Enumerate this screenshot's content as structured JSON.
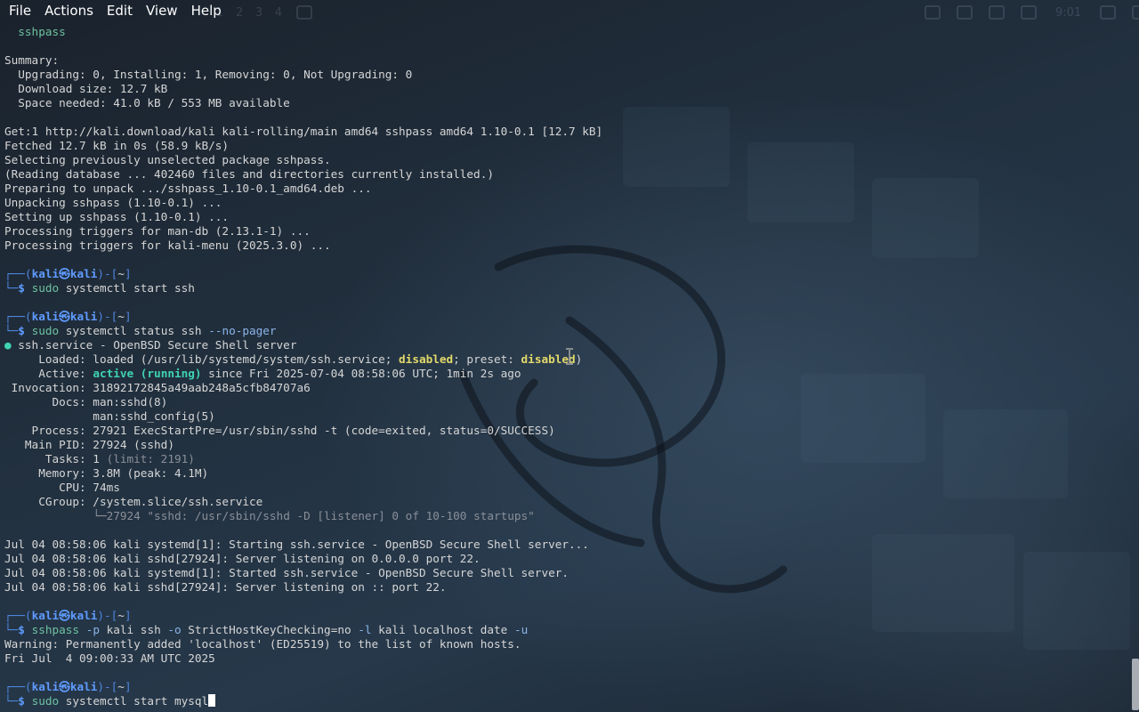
{
  "menu": [
    "File",
    "Actions",
    "Edit",
    "View",
    "Help"
  ],
  "ghost_panel": {
    "workspaces": [
      "1",
      "2",
      "3",
      "4"
    ],
    "clock": "9:01"
  },
  "prompt": {
    "user": "kali",
    "sep": "㉿",
    "host": "kali",
    "dir": "~"
  },
  "lines": [
    {
      "t": "out",
      "s": [
        {
          "c": "green",
          "x": "  sshpass"
        }
      ]
    },
    {
      "t": "blank"
    },
    {
      "t": "out",
      "s": [
        {
          "x": "Summary:"
        }
      ]
    },
    {
      "t": "out",
      "s": [
        {
          "x": "  Upgrading: 0, Installing: 1, Removing: 0, Not Upgrading: 0"
        }
      ]
    },
    {
      "t": "out",
      "s": [
        {
          "x": "  Download size: 12.7 kB"
        }
      ]
    },
    {
      "t": "out",
      "s": [
        {
          "x": "  Space needed: 41.0 kB / 553 MB available"
        }
      ]
    },
    {
      "t": "blank"
    },
    {
      "t": "out",
      "s": [
        {
          "x": "Get:1 http://kali.download/kali kali-rolling/main amd64 sshpass amd64 1.10-0.1 [12.7 kB]"
        }
      ]
    },
    {
      "t": "out",
      "s": [
        {
          "x": "Fetched 12.7 kB in 0s (58.9 kB/s)"
        }
      ]
    },
    {
      "t": "out",
      "s": [
        {
          "x": "Selecting previously unselected package sshpass."
        }
      ]
    },
    {
      "t": "out",
      "s": [
        {
          "x": "(Reading database ... 402460 files and directories currently installed.)"
        }
      ]
    },
    {
      "t": "out",
      "s": [
        {
          "x": "Preparing to unpack .../sshpass_1.10-0.1_amd64.deb ..."
        }
      ]
    },
    {
      "t": "out",
      "s": [
        {
          "x": "Unpacking sshpass (1.10-0.1) ..."
        }
      ]
    },
    {
      "t": "out",
      "s": [
        {
          "x": "Setting up sshpass (1.10-0.1) ..."
        }
      ]
    },
    {
      "t": "out",
      "s": [
        {
          "x": "Processing triggers for man-db (2.13.1-1) ..."
        }
      ]
    },
    {
      "t": "out",
      "s": [
        {
          "x": "Processing triggers for kali-menu (2025.3.0) ..."
        }
      ]
    },
    {
      "t": "blank"
    },
    {
      "t": "prompt"
    },
    {
      "t": "cmd",
      "s": [
        {
          "c": "green",
          "x": "sudo"
        },
        {
          "x": " systemctl start ssh"
        }
      ]
    },
    {
      "t": "blank"
    },
    {
      "t": "prompt"
    },
    {
      "t": "cmd",
      "s": [
        {
          "c": "green",
          "x": "sudo"
        },
        {
          "x": " systemctl status ssh "
        },
        {
          "c": "opt",
          "x": "--no-pager"
        }
      ]
    },
    {
      "t": "out",
      "s": [
        {
          "c": "dot",
          "x": "●"
        },
        {
          "x": " ssh.service - OpenBSD Secure Shell server"
        }
      ]
    },
    {
      "t": "out",
      "s": [
        {
          "x": "     Loaded: loaded (/usr/lib/systemd/system/ssh.service; "
        },
        {
          "c": "yellow",
          "x": "disabled"
        },
        {
          "x": "; preset: "
        },
        {
          "c": "yellow",
          "x": "disabled"
        },
        {
          "x": ")"
        }
      ]
    },
    {
      "t": "out",
      "s": [
        {
          "x": "     Active: "
        },
        {
          "c": "active",
          "x": "active (running)"
        },
        {
          "x": " since Fri 2025-07-04 08:58:06 UTC; 1min 2s ago"
        }
      ]
    },
    {
      "t": "out",
      "s": [
        {
          "x": " Invocation: 31892172845a49aab248a5cfb84707a6"
        }
      ]
    },
    {
      "t": "out",
      "s": [
        {
          "x": "       Docs: man:sshd(8)"
        }
      ]
    },
    {
      "t": "out",
      "s": [
        {
          "x": "             man:sshd_config(5)"
        }
      ]
    },
    {
      "t": "out",
      "s": [
        {
          "x": "    Process: 27921 ExecStartPre=/usr/sbin/sshd -t (code=exited, status=0/SUCCESS)"
        }
      ]
    },
    {
      "t": "out",
      "s": [
        {
          "x": "   Main PID: 27924 (sshd)"
        }
      ]
    },
    {
      "t": "out",
      "s": [
        {
          "x": "      Tasks: 1 "
        },
        {
          "c": "dim",
          "x": "(limit: 2191)"
        }
      ]
    },
    {
      "t": "out",
      "s": [
        {
          "x": "     Memory: 3.8M (peak: 4.1M)"
        }
      ]
    },
    {
      "t": "out",
      "s": [
        {
          "x": "        CPU: 74ms"
        }
      ]
    },
    {
      "t": "out",
      "s": [
        {
          "x": "     CGroup: /system.slice/ssh.service"
        }
      ]
    },
    {
      "t": "out",
      "s": [
        {
          "x": "             "
        },
        {
          "c": "dim",
          "x": "└─27924 \"sshd: /usr/sbin/sshd -D [listener] 0 of 10-100 startups\""
        }
      ]
    },
    {
      "t": "blank"
    },
    {
      "t": "out",
      "s": [
        {
          "x": "Jul 04 08:58:06 kali systemd[1]: Starting ssh.service - OpenBSD Secure Shell server..."
        }
      ]
    },
    {
      "t": "out",
      "s": [
        {
          "x": "Jul 04 08:58:06 kali sshd[27924]: Server listening on 0.0.0.0 port 22."
        }
      ]
    },
    {
      "t": "out",
      "s": [
        {
          "x": "Jul 04 08:58:06 kali systemd[1]: Started ssh.service - OpenBSD Secure Shell server."
        }
      ]
    },
    {
      "t": "out",
      "s": [
        {
          "x": "Jul 04 08:58:06 kali sshd[27924]: Server listening on :: port 22."
        }
      ]
    },
    {
      "t": "blank"
    },
    {
      "t": "prompt"
    },
    {
      "t": "cmd",
      "s": [
        {
          "c": "green",
          "x": "sshpass"
        },
        {
          "x": " "
        },
        {
          "c": "opt",
          "x": "-p"
        },
        {
          "x": " kali ssh "
        },
        {
          "c": "opt",
          "x": "-o"
        },
        {
          "x": " StrictHostKeyChecking=no "
        },
        {
          "c": "opt",
          "x": "-l"
        },
        {
          "x": " kali localhost date "
        },
        {
          "c": "opt",
          "x": "-u"
        }
      ]
    },
    {
      "t": "out",
      "s": [
        {
          "x": "Warning: Permanently added 'localhost' (ED25519) to the list of known hosts."
        }
      ]
    },
    {
      "t": "out",
      "s": [
        {
          "x": "Fri Jul  4 09:00:33 AM UTC 2025"
        }
      ]
    },
    {
      "t": "blank"
    },
    {
      "t": "prompt"
    },
    {
      "t": "cmd",
      "cursor": true,
      "s": [
        {
          "c": "green",
          "x": "sudo"
        },
        {
          "x": " systemctl start mysql"
        }
      ]
    }
  ]
}
